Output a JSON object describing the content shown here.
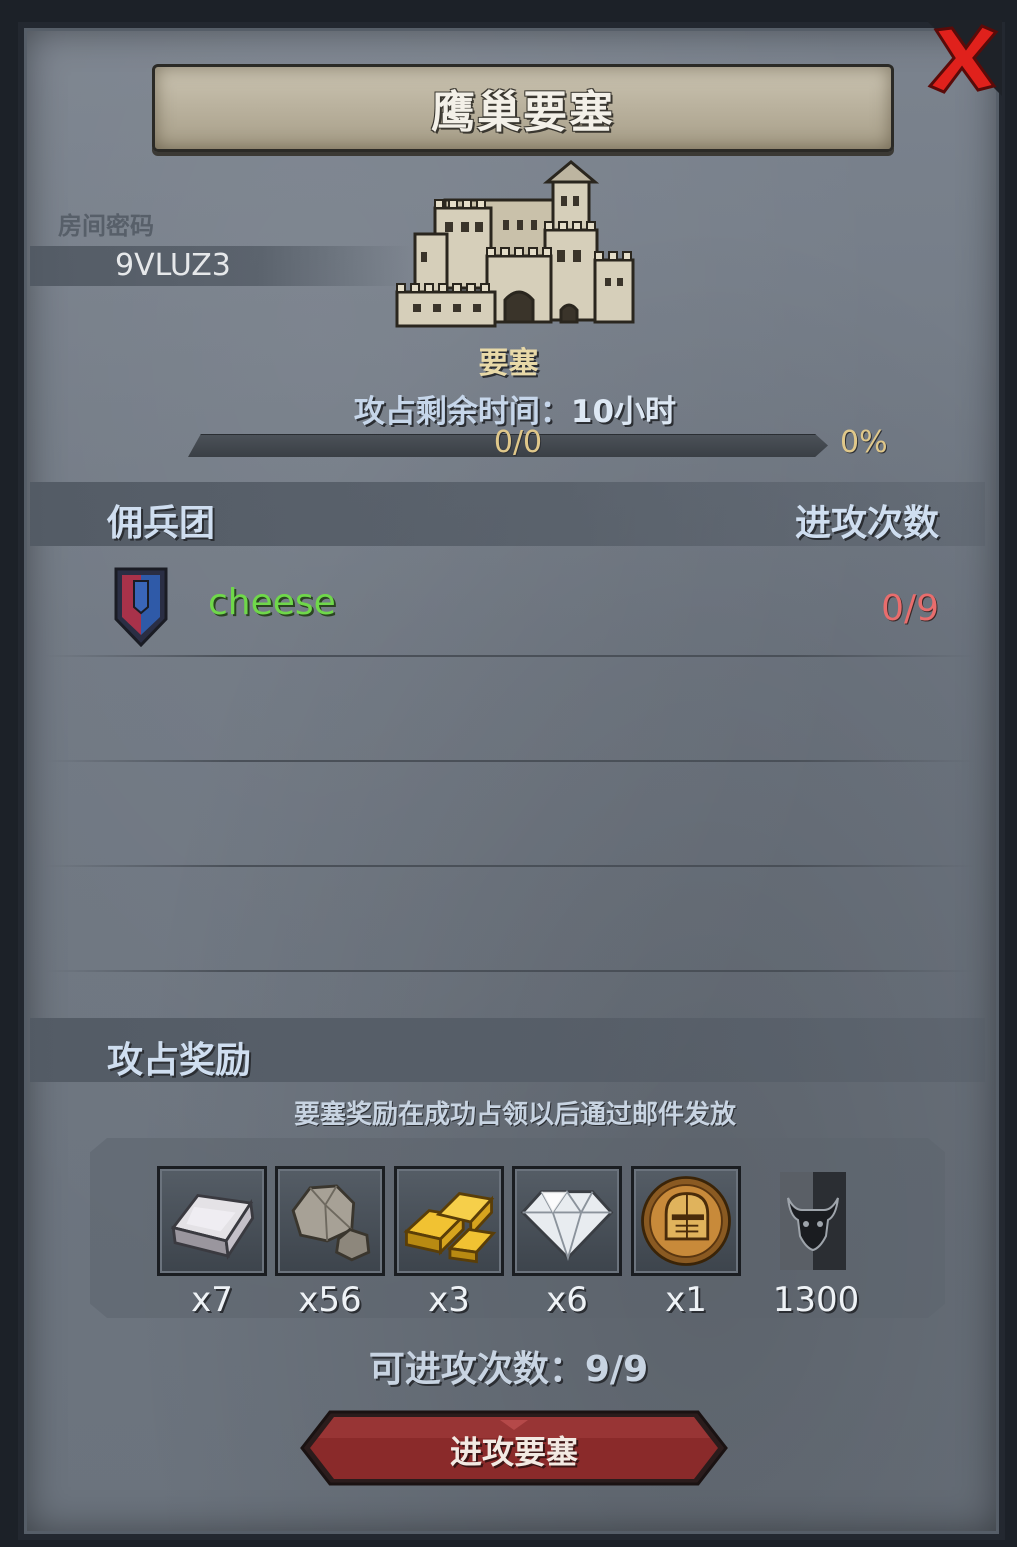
{
  "header": {
    "title": "鹰巢要塞"
  },
  "room": {
    "label": "房间密码",
    "code": "9VLUZ3"
  },
  "fortress": {
    "name": "要塞",
    "time_label": "攻占剩余时间：",
    "time_value": "10小时",
    "progress_text": "0/0",
    "progress_percent_text": "0%",
    "progress_fraction": 0
  },
  "mercenary_section": {
    "title": "佣兵团",
    "attacks_header": "进攻次数",
    "rows": [
      {
        "name": "cheese",
        "attacks": "0/9"
      }
    ]
  },
  "rewards_section": {
    "title": "攻占奖励",
    "note": "要塞奖励在成功占领以后通过邮件发放",
    "items": [
      {
        "icon": "iron-ingot-icon",
        "qty": "x7"
      },
      {
        "icon": "stone-icon",
        "qty": "x56"
      },
      {
        "icon": "gold-bars-icon",
        "qty": "x3"
      },
      {
        "icon": "diamond-icon",
        "qty": "x6"
      },
      {
        "icon": "knight-helmet-coin-icon",
        "qty": "x1"
      },
      {
        "icon": "bull-banner-icon",
        "qty": "1300"
      }
    ]
  },
  "footer": {
    "attacks_available": "可进攻次数：9/9",
    "attack_button": "进攻要塞"
  },
  "colors": {
    "panel": "#727a85",
    "title_banner": "#bdb5a1",
    "merc_name": "#6fd84a",
    "attacks_red": "#e86d6d",
    "button": "#8a2a2a"
  }
}
